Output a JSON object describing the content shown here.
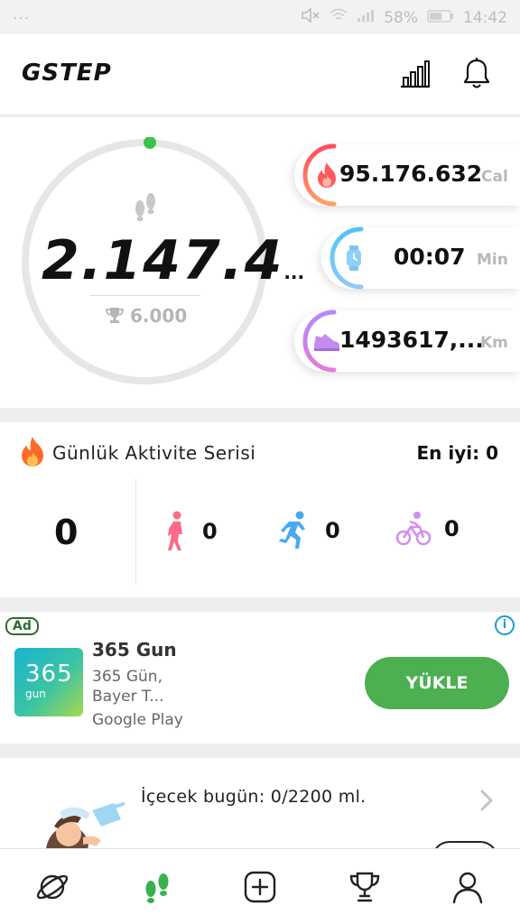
{
  "status_bar": {
    "dots": "...",
    "battery": "58%",
    "time": "14:42"
  },
  "header": {
    "logo": "GSTEP"
  },
  "steps": {
    "count": "2.147.4",
    "ellipsis": "...",
    "goal": "6.000",
    "progress_fraction": 0.0
  },
  "metrics": {
    "calories": {
      "value": "95.176.632",
      "unit": "Cal"
    },
    "time": {
      "value": "00:07",
      "unit": "Min"
    },
    "distance": {
      "value": "1493617,...",
      "unit": "Km"
    }
  },
  "activity": {
    "title": "Günlük Aktivite Serisi",
    "best": "En iyi: 0",
    "streak": "0",
    "walk": "0",
    "run": "0",
    "bike": "0"
  },
  "ad": {
    "badge": "Ad",
    "logo_text": "365",
    "logo_sub": "gun",
    "title": "365 Gun",
    "subtitle_line1": "365 Gün,",
    "subtitle_line2": "Bayer T...",
    "store": "Google Play",
    "install": "YÜKLE"
  },
  "drink": {
    "label": "İçecek bugün: 0/2200 ml."
  },
  "colors": {
    "accent_green": "#4caf50",
    "ring_gray": "#e6e6e6",
    "calorie_gradient": [
      "#ff4b5c",
      "#ff9f6b"
    ],
    "time_gradient": [
      "#4fc3f7",
      "#90caf9"
    ],
    "distance_gradient": [
      "#b388ff",
      "#e57cd8"
    ]
  }
}
